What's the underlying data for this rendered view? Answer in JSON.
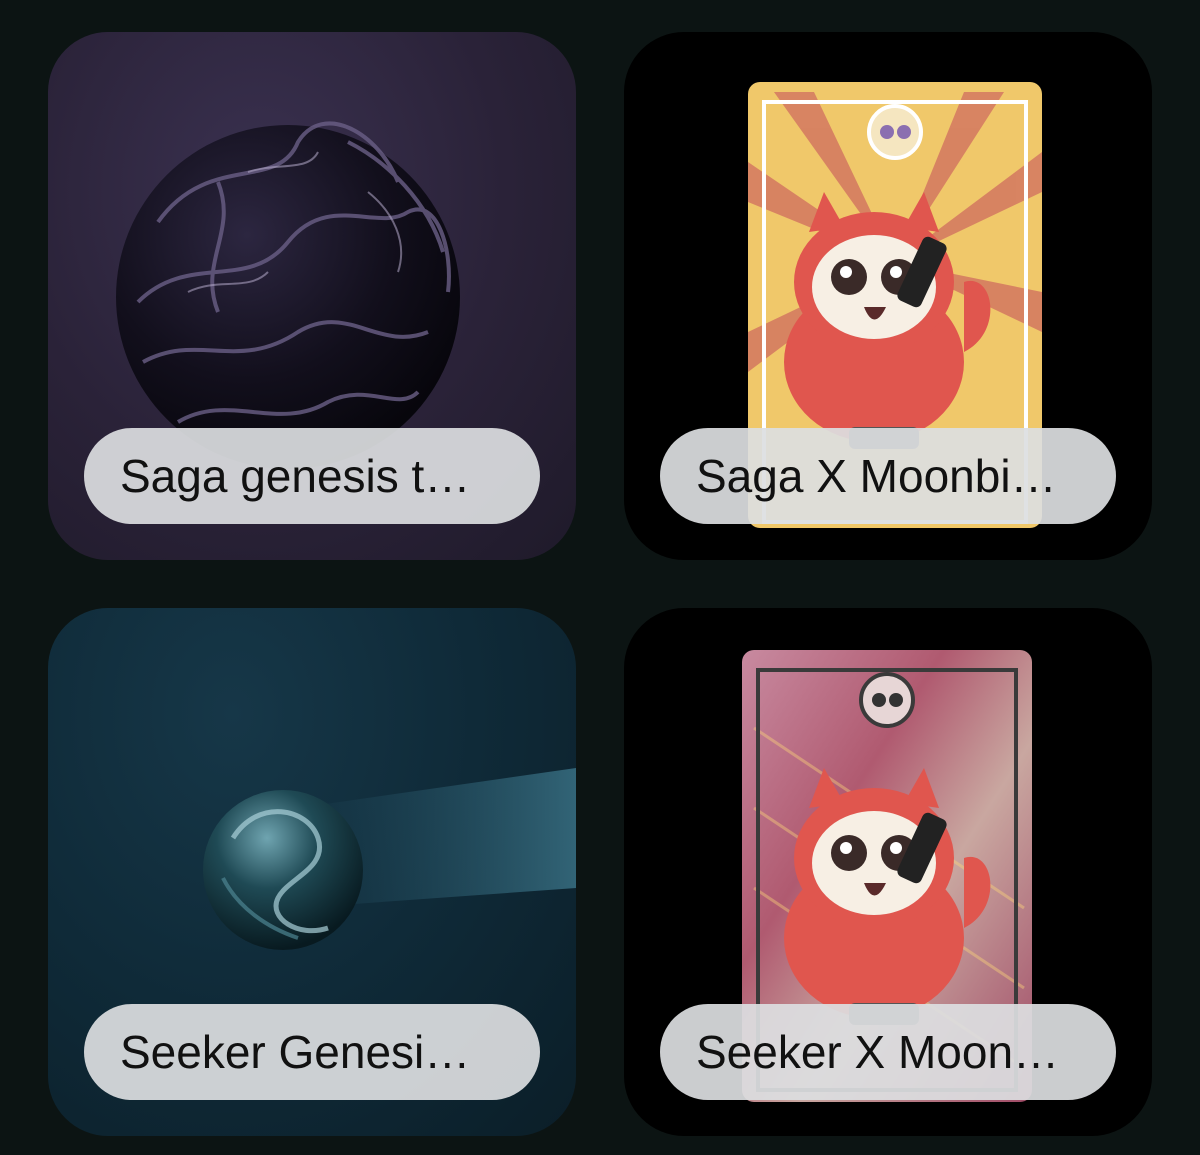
{
  "items": [
    {
      "label": "Saga genesis t…"
    },
    {
      "label": "Saga X Moonbi…"
    },
    {
      "label": "Seeker Genesi…"
    },
    {
      "label": "Seeker X Moon…"
    }
  ],
  "colors": {
    "background": "#0c1413",
    "pill": "#dcdee1",
    "card1": "#2a2238",
    "card3": "#0f2a38",
    "owl": "#e0564e",
    "cardGold": "#f0c86a"
  }
}
